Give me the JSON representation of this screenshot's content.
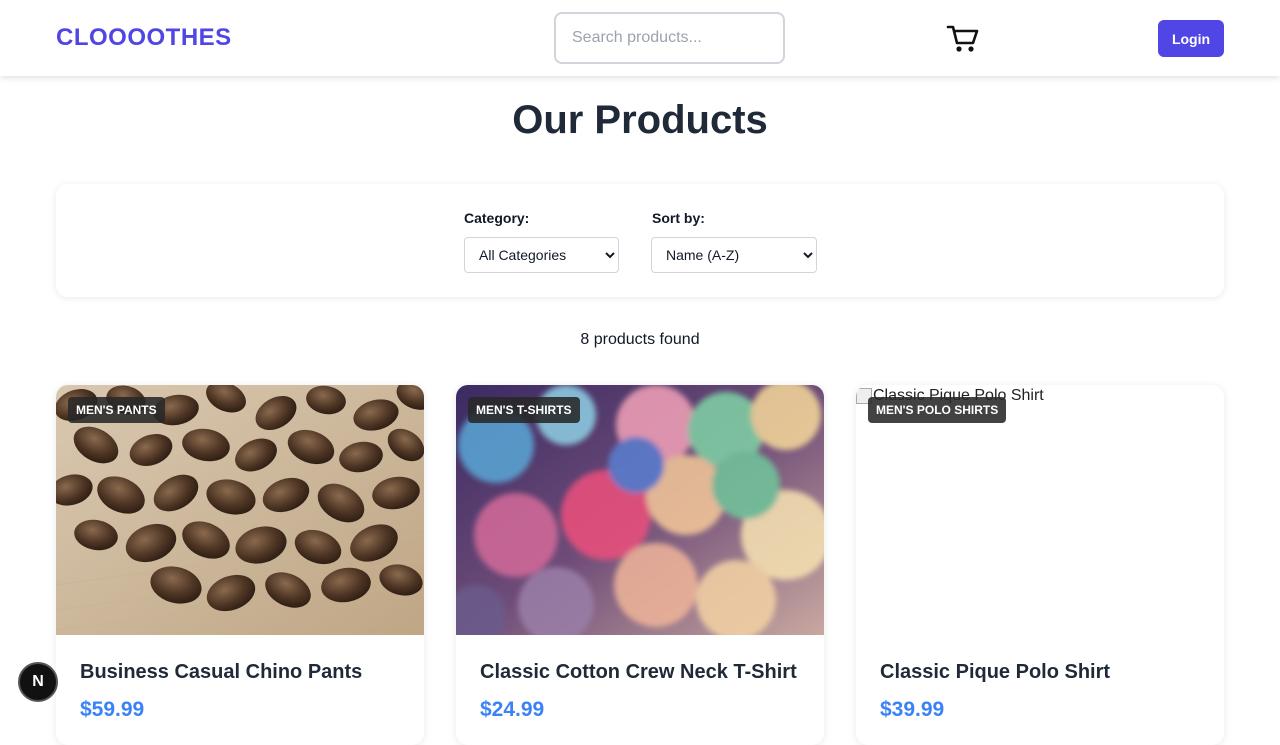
{
  "brand": {
    "name": "CLOOOOTHES",
    "color": "#4f46e5"
  },
  "header": {
    "search_placeholder": "Search products...",
    "cart_icon": "cart-icon",
    "login_label": "Login"
  },
  "main": {
    "title": "Our Products",
    "filters": {
      "category_label": "Category:",
      "category_selected": "All Categories",
      "sort_label": "Sort by:",
      "sort_selected": "Name (A-Z)"
    },
    "results_count": "8 products found"
  },
  "products": [
    {
      "category": "MEN'S PANTS",
      "name": "Business Casual Chino Pants",
      "price": "$59.99",
      "image": "coffee-beans-photo"
    },
    {
      "category": "MEN'S T-SHIRTS",
      "name": "Classic Cotton Crew Neck T-Shirt",
      "price": "$24.99",
      "image": "bokeh-lights-photo"
    },
    {
      "category": "MEN'S POLO SHIRTS",
      "name": "Classic Pique Polo Shirt",
      "price": "$39.99",
      "image_alt": "Classic Pique Polo Shirt"
    }
  ],
  "colors": {
    "price": "#3b82f6",
    "accent": "#4f46e5"
  },
  "dev_badge": {
    "label": "N"
  }
}
